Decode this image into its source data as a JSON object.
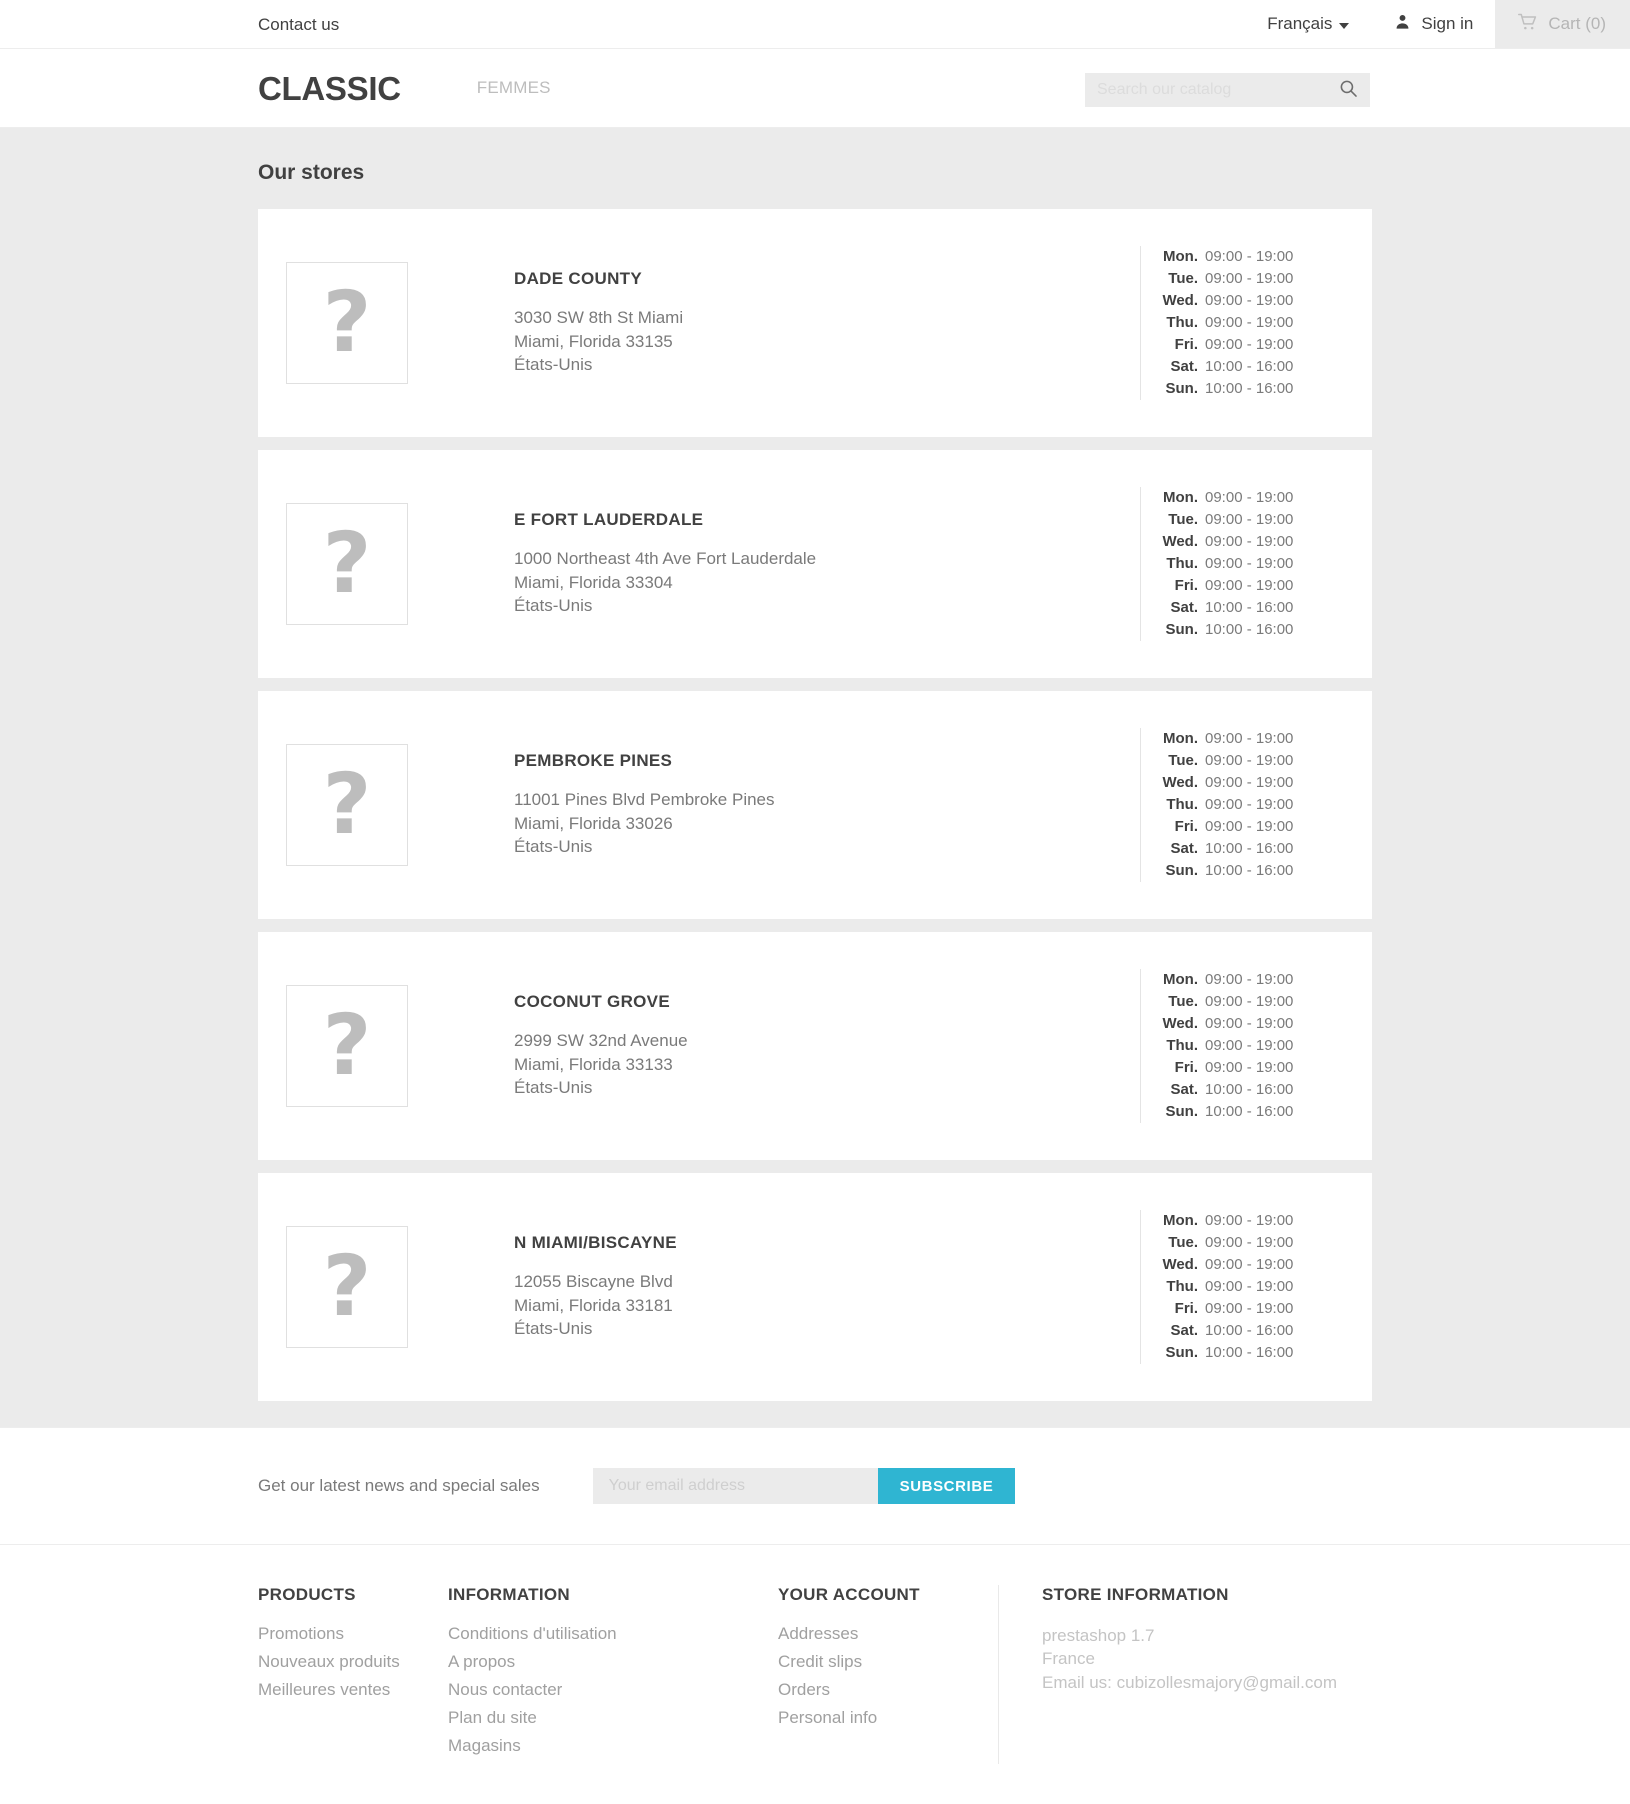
{
  "topbar": {
    "contact_label": "Contact us",
    "language": "Français",
    "signin_label": "Sign in",
    "cart_label": "Cart (0)",
    "cart_count": 0
  },
  "header": {
    "logo": "CLASSIC",
    "menu": [
      {
        "label": "FEMMES"
      }
    ],
    "search": {
      "placeholder": "Search our catalog",
      "value": ""
    }
  },
  "main": {
    "page_title": "Our stores",
    "thumb_glyph": "?",
    "stores": [
      {
        "name": "DADE COUNTY",
        "address_line1": "3030 SW 8th St Miami",
        "address_line2": "Miami, Florida 33135",
        "country": "États-Unis",
        "hours": [
          {
            "day": "Mon.",
            "time": "09:00 - 19:00"
          },
          {
            "day": "Tue.",
            "time": "09:00 - 19:00"
          },
          {
            "day": "Wed.",
            "time": "09:00 - 19:00"
          },
          {
            "day": "Thu.",
            "time": "09:00 - 19:00"
          },
          {
            "day": "Fri.",
            "time": "09:00 - 19:00"
          },
          {
            "day": "Sat.",
            "time": "10:00 - 16:00"
          },
          {
            "day": "Sun.",
            "time": "10:00 - 16:00"
          }
        ]
      },
      {
        "name": "E FORT LAUDERDALE",
        "address_line1": "1000 Northeast 4th Ave Fort Lauderdale",
        "address_line2": "Miami, Florida 33304",
        "country": "États-Unis",
        "hours": [
          {
            "day": "Mon.",
            "time": "09:00 - 19:00"
          },
          {
            "day": "Tue.",
            "time": "09:00 - 19:00"
          },
          {
            "day": "Wed.",
            "time": "09:00 - 19:00"
          },
          {
            "day": "Thu.",
            "time": "09:00 - 19:00"
          },
          {
            "day": "Fri.",
            "time": "09:00 - 19:00"
          },
          {
            "day": "Sat.",
            "time": "10:00 - 16:00"
          },
          {
            "day": "Sun.",
            "time": "10:00 - 16:00"
          }
        ]
      },
      {
        "name": "PEMBROKE PINES",
        "address_line1": "11001 Pines Blvd Pembroke Pines",
        "address_line2": "Miami, Florida 33026",
        "country": "États-Unis",
        "hours": [
          {
            "day": "Mon.",
            "time": "09:00 - 19:00"
          },
          {
            "day": "Tue.",
            "time": "09:00 - 19:00"
          },
          {
            "day": "Wed.",
            "time": "09:00 - 19:00"
          },
          {
            "day": "Thu.",
            "time": "09:00 - 19:00"
          },
          {
            "day": "Fri.",
            "time": "09:00 - 19:00"
          },
          {
            "day": "Sat.",
            "time": "10:00 - 16:00"
          },
          {
            "day": "Sun.",
            "time": "10:00 - 16:00"
          }
        ]
      },
      {
        "name": "COCONUT GROVE",
        "address_line1": "2999 SW 32nd Avenue",
        "address_line2": "Miami, Florida 33133",
        "country": "États-Unis",
        "hours": [
          {
            "day": "Mon.",
            "time": "09:00 - 19:00"
          },
          {
            "day": "Tue.",
            "time": "09:00 - 19:00"
          },
          {
            "day": "Wed.",
            "time": "09:00 - 19:00"
          },
          {
            "day": "Thu.",
            "time": "09:00 - 19:00"
          },
          {
            "day": "Fri.",
            "time": "09:00 - 19:00"
          },
          {
            "day": "Sat.",
            "time": "10:00 - 16:00"
          },
          {
            "day": "Sun.",
            "time": "10:00 - 16:00"
          }
        ]
      },
      {
        "name": "N MIAMI/BISCAYNE",
        "address_line1": "12055 Biscayne Blvd",
        "address_line2": "Miami, Florida 33181",
        "country": "États-Unis",
        "hours": [
          {
            "day": "Mon.",
            "time": "09:00 - 19:00"
          },
          {
            "day": "Tue.",
            "time": "09:00 - 19:00"
          },
          {
            "day": "Wed.",
            "time": "09:00 - 19:00"
          },
          {
            "day": "Thu.",
            "time": "09:00 - 19:00"
          },
          {
            "day": "Fri.",
            "time": "09:00 - 19:00"
          },
          {
            "day": "Sat.",
            "time": "10:00 - 16:00"
          },
          {
            "day": "Sun.",
            "time": "10:00 - 16:00"
          }
        ]
      }
    ]
  },
  "newsletter": {
    "text": "Get our latest news and special sales",
    "placeholder": "Your email address",
    "value": "",
    "button_label": "SUBSCRIBE"
  },
  "footer": {
    "columns": [
      {
        "title": "PRODUCTS",
        "links": [
          "Promotions",
          "Nouveaux produits",
          "Meilleures ventes"
        ]
      },
      {
        "title": "INFORMATION",
        "links": [
          "Conditions d'utilisation",
          "A propos",
          "Nous contacter",
          "Plan du site",
          "Magasins"
        ]
      },
      {
        "title": "YOUR ACCOUNT",
        "links": [
          "Addresses",
          "Credit slips",
          "Orders",
          "Personal info"
        ]
      }
    ],
    "store_information": {
      "title": "STORE INFORMATION",
      "lines": [
        "prestashop 1.7",
        "France",
        "Email us: cubizollesmajory@gmail.com"
      ]
    }
  },
  "colors": {
    "accent": "#2fb5d2",
    "page_bg": "#ebebeb",
    "text_dark": "#414141",
    "text_muted": "#7a7a7a"
  }
}
